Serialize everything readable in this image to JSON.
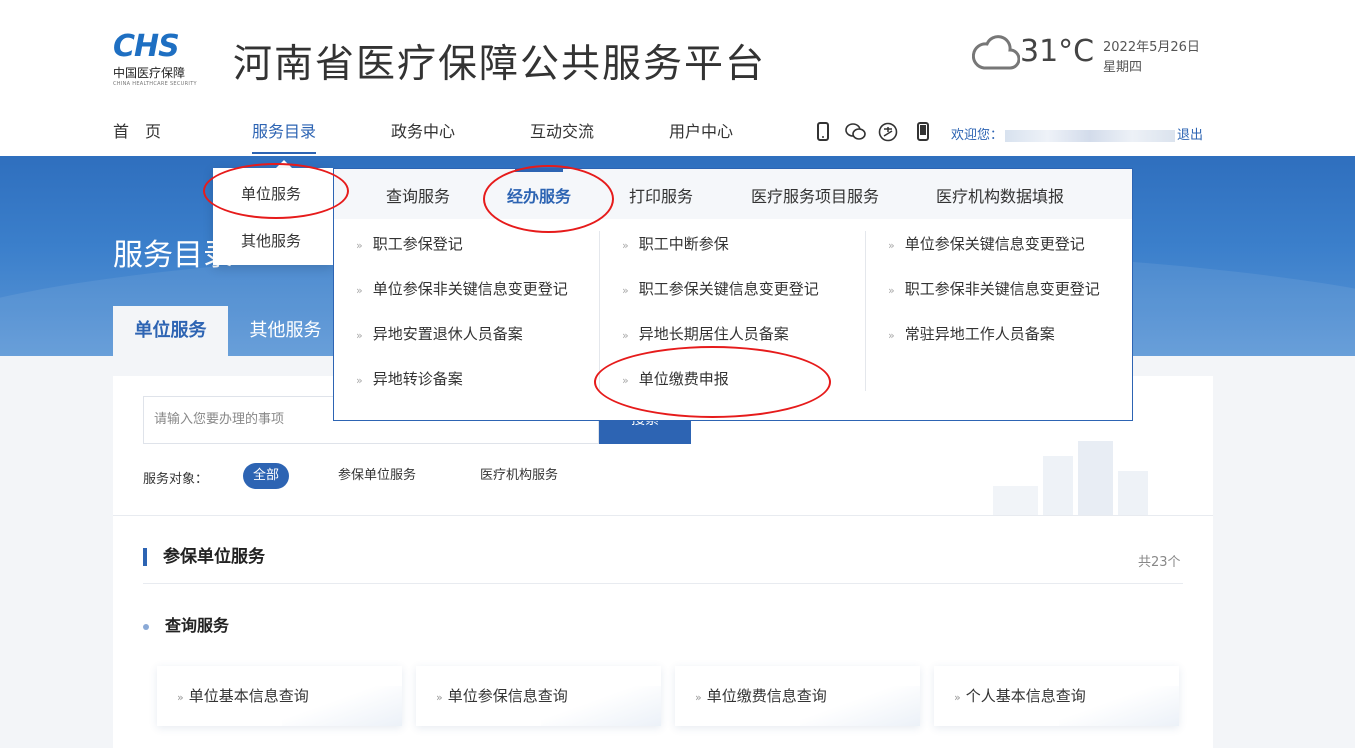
{
  "header": {
    "logo_mark": "CHS",
    "logo_cn": "中国医疗保障",
    "logo_en": "CHINA HEALTHCARE SECURITY",
    "site_title": "河南省医疗保障公共服务平台",
    "weather": {
      "temp": "31°C",
      "date": "2022年5月26日",
      "weekday": "星期四",
      "icon": "cloud-icon"
    }
  },
  "nav": {
    "items": [
      {
        "label": "首　页"
      },
      {
        "label": "服务目录"
      },
      {
        "label": "政务中心"
      },
      {
        "label": "互动交流"
      },
      {
        "label": "用户中心"
      }
    ],
    "icons": [
      "mobile-icon",
      "wechat-icon",
      "alipay-icon",
      "phone-icon"
    ],
    "welcome_label": "欢迎您：",
    "logout": "退出"
  },
  "banner": {
    "title": "服务目录",
    "tabs": [
      {
        "label": "单位服务"
      },
      {
        "label": "其他服务"
      }
    ]
  },
  "search": {
    "placeholder": "请输入您要办理的事项",
    "button": "搜索"
  },
  "filter": {
    "label": "服务对象：",
    "options": [
      {
        "label": "全部"
      },
      {
        "label": "参保单位服务"
      },
      {
        "label": "医疗机构服务"
      }
    ]
  },
  "section": {
    "title": "参保单位服务",
    "count": "共23个",
    "subsection": "查询服务",
    "cards": [
      {
        "label": "单位基本信息查询"
      },
      {
        "label": "单位参保信息查询"
      },
      {
        "label": "单位缴费信息查询"
      },
      {
        "label": "个人基本信息查询"
      }
    ]
  },
  "dropdown": {
    "left_items": [
      {
        "label": "单位服务"
      },
      {
        "label": "其他服务"
      }
    ],
    "tabs": [
      {
        "label": "查询服务"
      },
      {
        "label": "经办服务"
      },
      {
        "label": "打印服务"
      },
      {
        "label": "医疗服务项目服务"
      },
      {
        "label": "医疗机构数据填报"
      }
    ],
    "columns": [
      [
        {
          "label": "职工参保登记"
        },
        {
          "label": "单位参保非关键信息变更登记"
        },
        {
          "label": "异地安置退休人员备案"
        },
        {
          "label": "异地转诊备案"
        }
      ],
      [
        {
          "label": "职工中断参保"
        },
        {
          "label": "职工参保关键信息变更登记"
        },
        {
          "label": "异地长期居住人员备案"
        },
        {
          "label": "单位缴费申报"
        }
      ],
      [
        {
          "label": "单位参保关键信息变更登记"
        },
        {
          "label": "职工参保非关键信息变更登记"
        },
        {
          "label": "常驻异地工作人员备案"
        }
      ]
    ]
  }
}
